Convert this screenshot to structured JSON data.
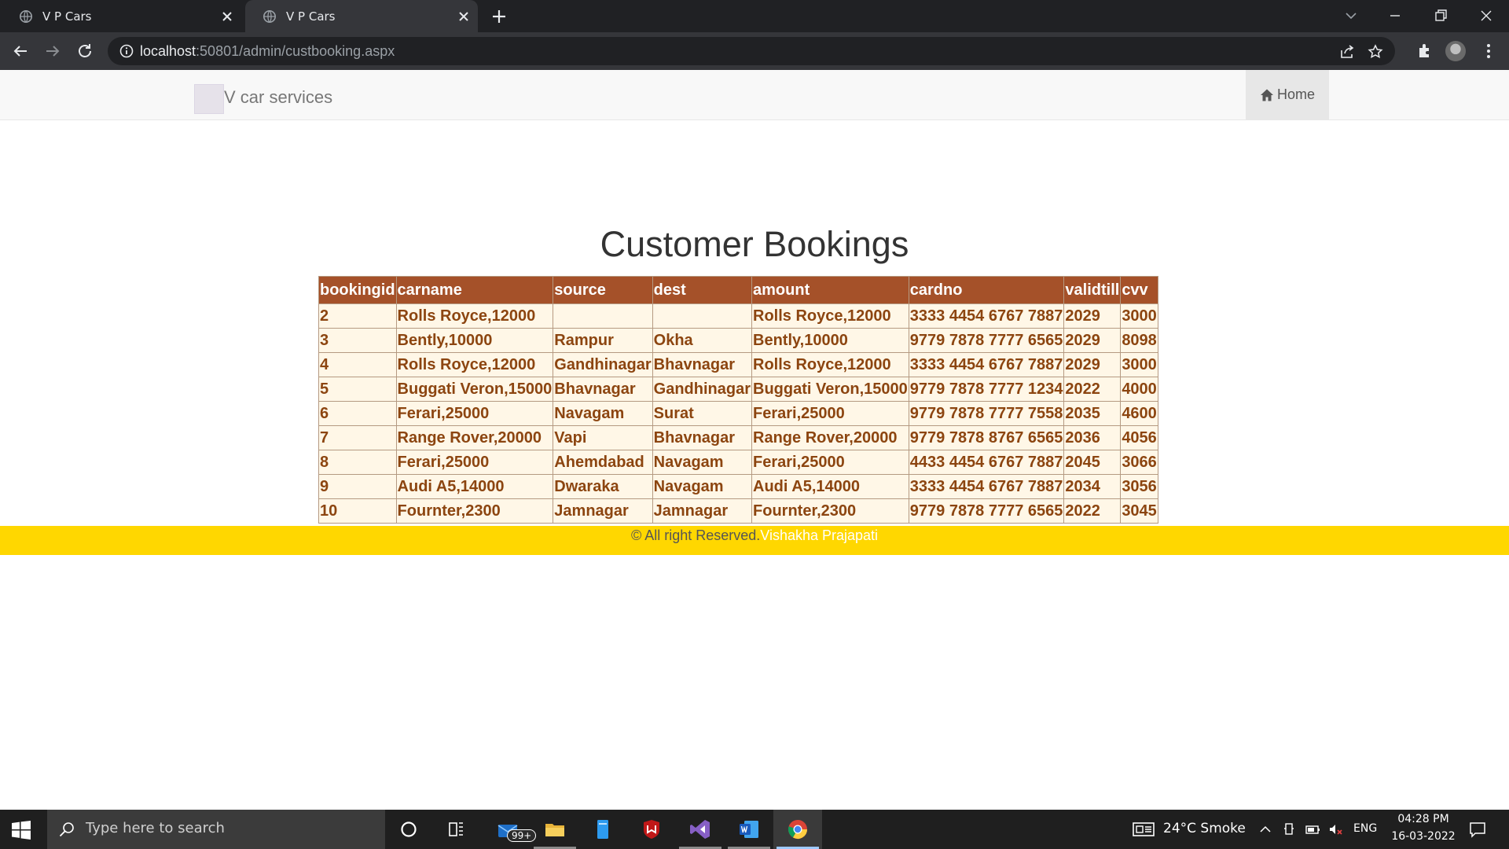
{
  "browser": {
    "tabs": [
      {
        "title": "V P Cars",
        "active": false
      },
      {
        "title": "V P Cars",
        "active": true
      }
    ],
    "url_host": "localhost",
    "url_rest": ":50801/admin/custbooking.aspx"
  },
  "navbar": {
    "brand": "V car services",
    "home_label": "Home"
  },
  "page": {
    "heading": "Customer Bookings"
  },
  "bookings": {
    "columns": [
      "bookingid",
      "carname",
      "source",
      "dest",
      "amount",
      "cardno",
      "validtill",
      "cvv"
    ],
    "rows": [
      [
        "2",
        "Rolls Royce,12000",
        "",
        "",
        "Rolls Royce,12000",
        "3333 4454 6767 7887",
        "2029",
        "3000"
      ],
      [
        "3",
        "Bently,10000",
        "Rampur",
        "Okha",
        "Bently,10000",
        "9779 7878 7777 6565",
        "2029",
        "8098"
      ],
      [
        "4",
        "Rolls Royce,12000",
        "Gandhinagar",
        "Bhavnagar",
        "Rolls Royce,12000",
        "3333 4454 6767 7887",
        "2029",
        "3000"
      ],
      [
        "5",
        "Buggati Veron,15000",
        "Bhavnagar",
        "Gandhinagar",
        "Buggati Veron,15000",
        "9779 7878 7777 1234",
        "2022",
        "4000"
      ],
      [
        "6",
        "Ferari,25000",
        "Navagam",
        "Surat",
        "Ferari,25000",
        "9779 7878 7777 7558",
        "2035",
        "4600"
      ],
      [
        "7",
        "Range Rover,20000",
        "Vapi",
        "Bhavnagar",
        "Range Rover,20000",
        "9779 7878 8767 6565",
        "2036",
        "4056"
      ],
      [
        "8",
        "Ferari,25000",
        "Ahemdabad",
        "Navagam",
        "Ferari,25000",
        "4433 4454 6767 7887",
        "2045",
        "3066"
      ],
      [
        "9",
        "Audi A5,14000",
        "Dwaraka",
        "Navagam",
        "Audi A5,14000",
        "3333 4454 6767 7887",
        "2034",
        "3056"
      ],
      [
        "10",
        "Fournter,2300",
        "Jamnagar",
        "Jamnagar",
        "Fournter,2300",
        "9779 7878 7777 6565",
        "2022",
        "3045"
      ]
    ]
  },
  "footer": {
    "rights": "© All right Reserved.",
    "author": "Vishakha Prajapati"
  },
  "taskbar": {
    "search_placeholder": "Type here to search",
    "mail_badge": "99+",
    "weather": "24°C  Smoke",
    "language": "ENG",
    "time": "04:28 PM",
    "date": "16-03-2022"
  },
  "colors": {
    "header_bg": "#a55129",
    "row_bg": "#fff7e7",
    "row_text": "#8c4510",
    "footer_bg": "#ffd700"
  }
}
